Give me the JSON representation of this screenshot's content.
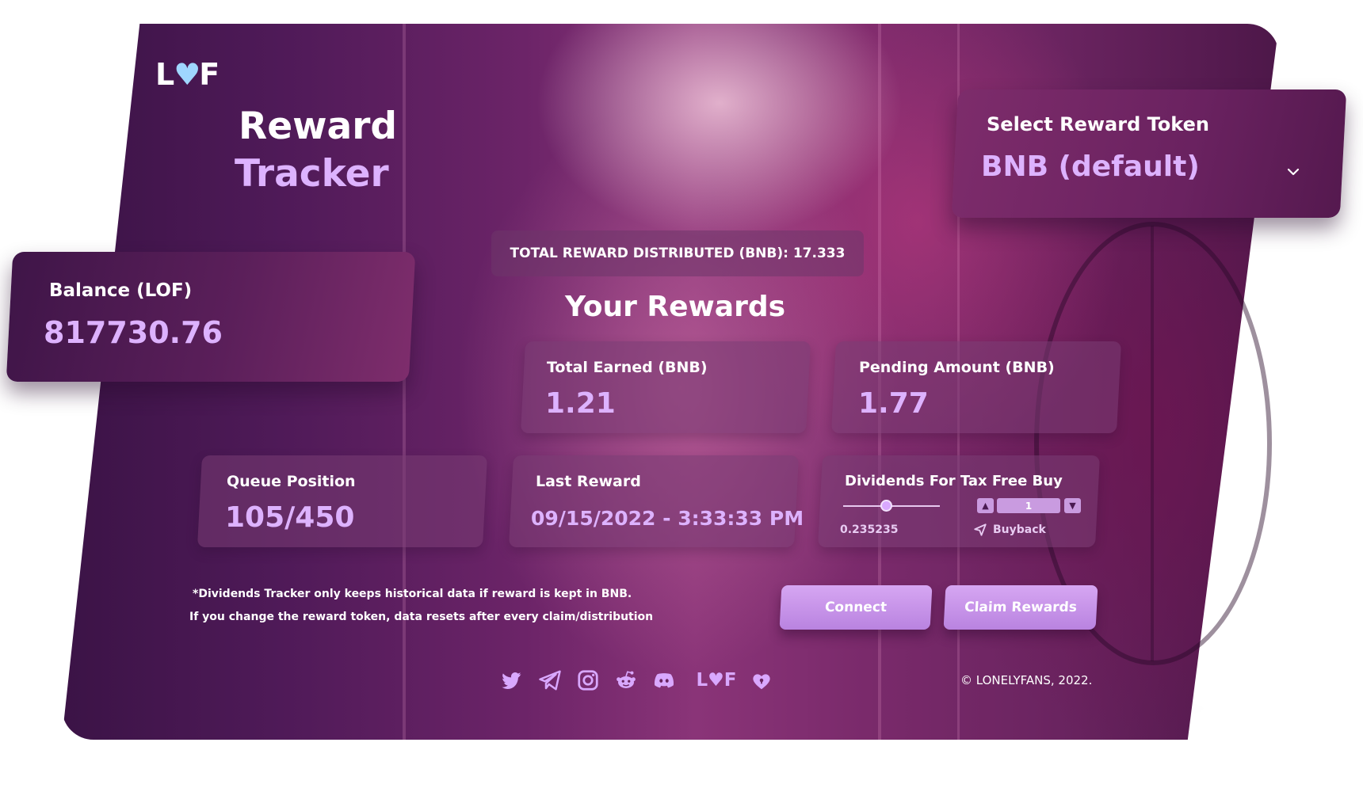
{
  "brand": {
    "logo_left": "L",
    "logo_right": "F"
  },
  "header": {
    "title_line1": "Reward",
    "title_line2": "Tracker"
  },
  "token_select": {
    "label": "Select Reward Token",
    "selected": "BNB (default)"
  },
  "balance": {
    "label": "Balance (LOF)",
    "value": "817730.76"
  },
  "total_distributed": "TOTAL REWARD DISTRIBUTED (BNB): 17.333",
  "rewards_heading": "Your Rewards",
  "stats": {
    "total_earned": {
      "label": "Total Earned (BNB)",
      "value": "1.21"
    },
    "pending": {
      "label": "Pending Amount (BNB)",
      "value": "1.77"
    },
    "queue": {
      "label": "Queue Position",
      "value": "105/450"
    },
    "last_reward": {
      "label": "Last Reward",
      "value": "09/15/2022 - 3:33:33 PM"
    }
  },
  "dividends": {
    "label": "Dividends For Tax Free Buy",
    "slider_value": "0.235235",
    "slider_fraction": 0.45,
    "stepper_value": "1",
    "buyback_label": "Buyback"
  },
  "notes": {
    "line1": "*Dividends Tracker only keeps historical data if reward is kept in BNB.",
    "line2": "If you change the reward token, data resets after every claim/distribution"
  },
  "buttons": {
    "connect": "Connect",
    "claim": "Claim Rewards"
  },
  "social_icons": [
    "twitter-icon",
    "telegram-icon",
    "instagram-icon",
    "reddit-icon",
    "discord-icon",
    "lof-logo-icon",
    "lof-heart-icon"
  ],
  "footer": {
    "copyright": "© LONELYFANS, 2022."
  },
  "colors": {
    "accent": "#ddb2ff",
    "button": "#c495ea",
    "card": "#6a2260",
    "logo_heart": "#9fd6ff"
  }
}
